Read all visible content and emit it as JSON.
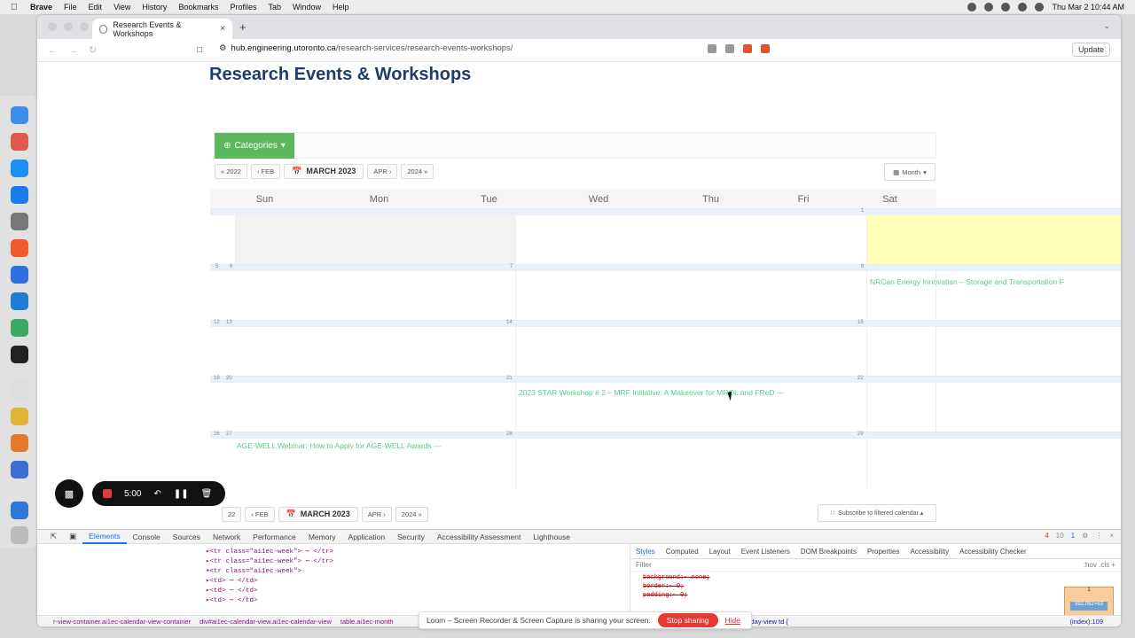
{
  "menubar": {
    "app": "Brave",
    "items": [
      "File",
      "Edit",
      "View",
      "History",
      "Bookmarks",
      "Profiles",
      "Tab",
      "Window",
      "Help"
    ],
    "clock": "Thu Mar 2  10:44 AM"
  },
  "browser": {
    "tab_title": "Research Events & Workshops",
    "url_host": "hub.engineering.utoronto.ca",
    "url_path": "/research-services/research-events-workshops/",
    "update_label": "Update"
  },
  "page": {
    "title": "Research Events & Workshops",
    "categories_label": "Categories",
    "nav": {
      "prev_year": "« 2022",
      "prev_month": "‹ FEB",
      "current": "MARCH 2023",
      "next_month": "APR ›",
      "next_year": "2024 »"
    },
    "month_view_label": "Month",
    "weekdays": [
      "Sun",
      "Mon",
      "Tue",
      "Wed",
      "Thu",
      "Fri",
      "Sat"
    ],
    "weeks": [
      {
        "nums": [
          "",
          "",
          "",
          "1",
          ""
        ]
      },
      {
        "nums": [
          "5",
          "6",
          "7",
          "8",
          ""
        ],
        "event_sat": "NRCan Energy Innovation – Storage and Transportation F"
      },
      {
        "nums": [
          "12",
          "13",
          "14",
          "15",
          ""
        ]
      },
      {
        "nums": [
          "19",
          "20",
          "21",
          "22",
          ""
        ],
        "event_wed": "2023 STAR Workshop # 2 – MRF Initiative: A Makeover for MROL and FReD ---"
      },
      {
        "nums": [
          "26",
          "27",
          "28",
          "29",
          ""
        ],
        "event_mon": "AGE-WELL Webinar: How to Apply for AGE-WELL Awards ---"
      }
    ],
    "bottom_nav": {
      "prev_year": "22",
      "prev_month": "‹ FEB",
      "current": "MARCH 2023",
      "next_month": "APR ›",
      "next_year": "2024 »"
    },
    "subscribe_label": "Subscribe to filtered calendar ▴"
  },
  "recorder": {
    "time": "5:00"
  },
  "devtools": {
    "tabs": [
      "Elements",
      "Console",
      "Sources",
      "Network",
      "Performance",
      "Memory",
      "Application",
      "Security",
      "Accessibility Assessment",
      "Lighthouse"
    ],
    "errors": "4",
    "warnings": "10",
    "messages": "1",
    "elements_lines": [
      "▸<tr class=\"ai1ec-week\"> ⋯ </tr>",
      "▸<tr class=\"ai1ec-week\"> ⋯ </tr>",
      "▾<tr class=\"ai1ec-week\">",
      "  ▸<td> ⋯ </td>",
      "  ▸<td> ⋯ </td>",
      "  ▸<td> ⋯ </td>"
    ],
    "style_tabs": [
      "Styles",
      "Computed",
      "Layout",
      "Event Listeners",
      "DOM Breakpoints",
      "Properties",
      "Accessibility",
      "Accessibility Checker"
    ],
    "filter_placeholder": "Filter",
    "filter_tools": ":hov  .cls  +",
    "css_lines": [
      "background:▸ none;",
      "border:▸ 0;",
      "padding:▸ 0;"
    ],
    "box_label": "1",
    "box_inner": "592.062×63",
    "crumbs": [
      "r-view-container.ai1ec-calendar-view-container",
      "div#ai1ec-calendar-view.ai1ec-calendar-view",
      "table.ai1ec-month"
    ],
    "css_rule_tail": "ek-view td, .ai1ec-oneday-view td {",
    "css_source": "(index):109"
  },
  "loom": {
    "text": "Loom – Screen Recorder & Screen Capture is sharing your screen.",
    "stop": "Stop sharing",
    "hide": "Hide"
  }
}
